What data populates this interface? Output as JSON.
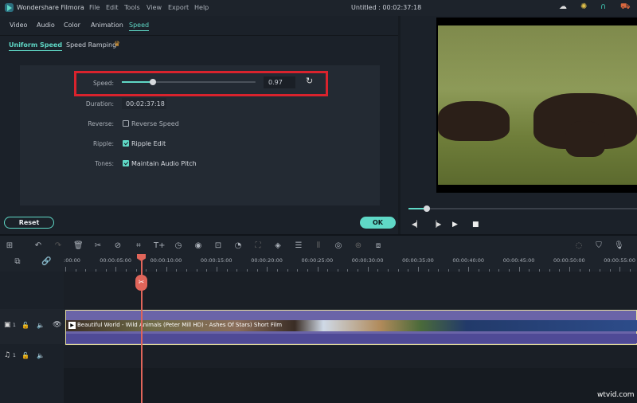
{
  "app": {
    "name": "Wondershare Filmora",
    "project_title": "Untitled : 00:02:37:18"
  },
  "menu": [
    "File",
    "Edit",
    "Tools",
    "View",
    "Export",
    "Help"
  ],
  "title_icons": [
    "cloud-icon",
    "lightbulb-icon",
    "headset-icon",
    "cart-icon"
  ],
  "tabs": [
    "Video",
    "Audio",
    "Color",
    "Animation",
    "Speed"
  ],
  "active_tab": "Speed",
  "subtabs": {
    "uniform": "Uniform Speed",
    "ramping": "Speed Ramping"
  },
  "speed_panel": {
    "speed_label": "Speed:",
    "speed_value": "0.97",
    "slider_fraction": 0.23,
    "duration_label": "Duration:",
    "duration_value": "00:02:37:18",
    "reverse_label": "Reverse:",
    "reverse_text": "Reverse Speed",
    "reverse_checked": false,
    "ripple_label": "Ripple:",
    "ripple_text": "Ripple Edit",
    "ripple_checked": true,
    "tones_label": "Tones:",
    "tones_text": "Maintain Audio Pitch",
    "tones_checked": true
  },
  "buttons": {
    "reset": "Reset",
    "ok": "OK"
  },
  "preview": {
    "progress_fraction": 0.08
  },
  "ruler": [
    ":00:00",
    "00:00:05:00",
    "00:00:10:00",
    "00:00:15:00",
    "00:00:20:00",
    "00:00:25:00",
    "00:00:30:00",
    "00:00:35:00",
    "00:00:40:00",
    "00:00:45:00",
    "00:00:50:00",
    "00:00:55:00"
  ],
  "tracks": {
    "video_num": "1",
    "audio_num": "1"
  },
  "clip": {
    "title": "Beautiful World - Wild Animals (Peter Mill HD) - Ashes Of Stars) Short Film"
  },
  "watermark": "wtvid.com",
  "colors": {
    "accent": "#5fd8c6",
    "highlight": "#d9232d",
    "playhead": "#e0655a",
    "clip": "#6a64a8"
  }
}
